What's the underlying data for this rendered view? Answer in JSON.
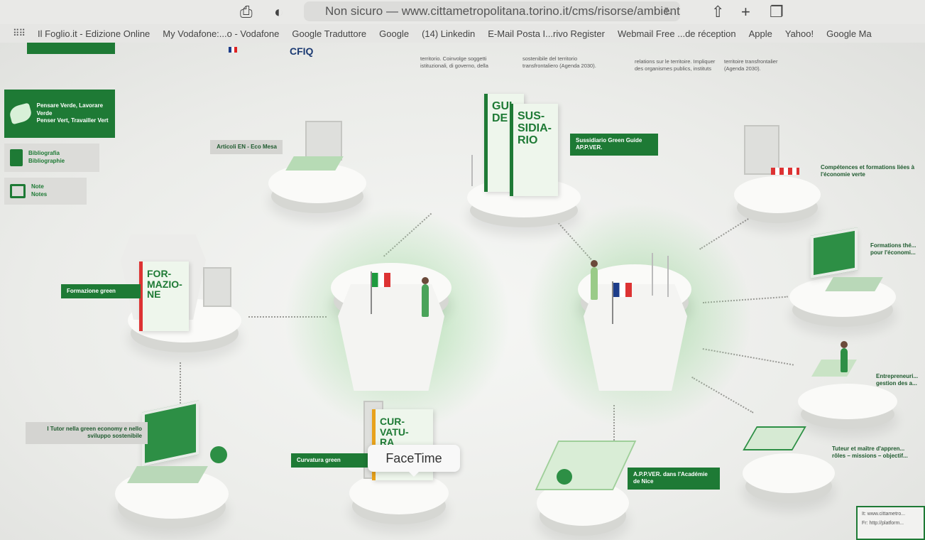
{
  "browser": {
    "url": "Non sicuro — www.cittametropolitana.torino.it/cms/risorse/ambiente",
    "bookmarks": [
      "Il Foglio.it - Edizione Online",
      "My Vodafone:...o - Vodafone",
      "Google Traduttore",
      "Google",
      "(14) Linkedin",
      "E-Mail Posta I...rivo Register",
      "Webmail Free ...de réception",
      "Apple",
      "Yahoo!",
      "Google Ma"
    ]
  },
  "header": {
    "cfiq": "CFIQ",
    "blurbs": [
      "territorio. Coinvolge soggetti istituzionali, di governo, della",
      "sostenibile del territorio transfrontaliero (Agenda 2030).",
      "relations sur le territoire. Impliquer des organismes publics, instituts",
      "territoire transfrontalier (Agenda 2030)."
    ]
  },
  "sidebar": [
    {
      "label_1": "Pensare Verde, Lavorare Verde",
      "label_2": "Penser Vert, Travailler Vert",
      "icon": "leaf-icon"
    },
    {
      "label_1": "Bibliografia",
      "label_2": "Bibliographie",
      "icon": "document-icon"
    },
    {
      "label_1": "Note",
      "label_2": "Notes",
      "icon": "edit-note-icon"
    }
  ],
  "labels": {
    "articoli": "Articoli EN - Eco Mesa",
    "sussidiario": "Sussidiario Green Guide AP.P.VER.",
    "competences": "Compétences et formations liées à l'économie verte",
    "formations": "Formations thé... pour l'économi...",
    "formazione": "Formazione green",
    "entrepreneuriat": "Entrepreneuri... gestion des a...",
    "tutor": "I Tutor nella green economy e nello sviluppo sostenibile",
    "curvatura": "Curvatura green",
    "academie": "A.P.P.VER. dans l'Académie de Nice",
    "tuteur": "Tuteur et maître d'appren... rôles – missions – objectif..."
  },
  "books": {
    "guide": "GUI-\nDE",
    "sussidiario": "SUS-\nSIDIA-\nRIO",
    "formazione": "FOR-\nMAZIO-\nNE",
    "curvatura": "CUR-\nVATU-\nRA"
  },
  "tooltip": "FaceTime",
  "qr": [
    "It: www.cittametro...",
    "Fr: http://platform..."
  ]
}
